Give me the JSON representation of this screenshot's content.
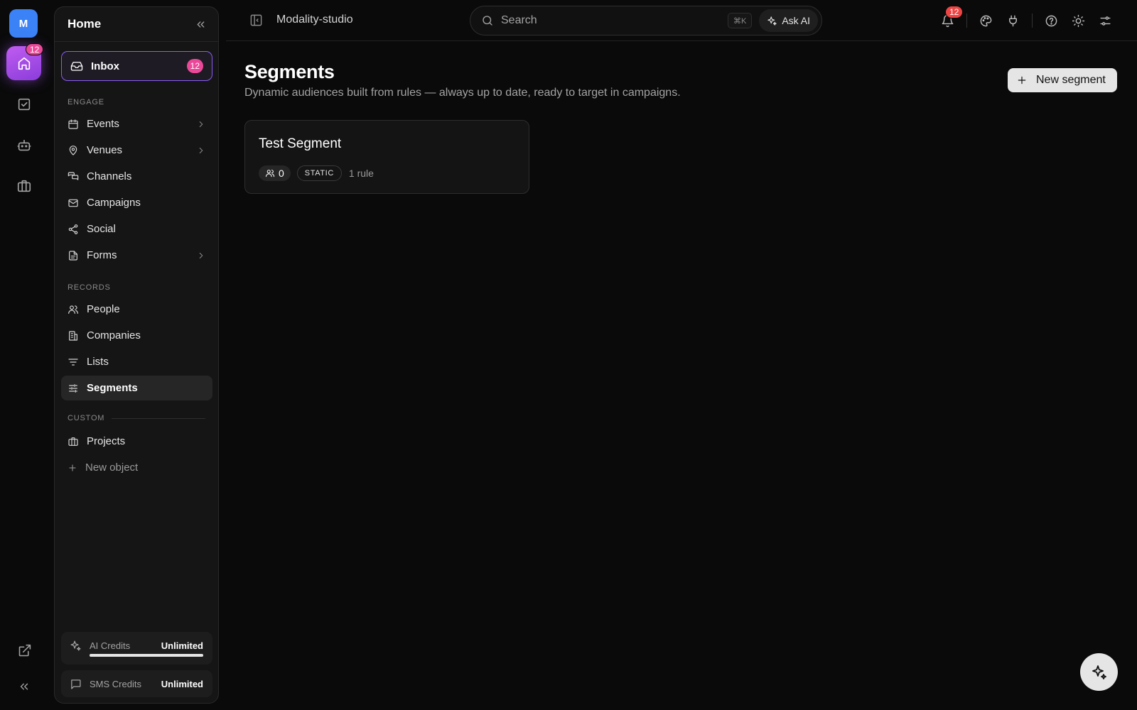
{
  "rail": {
    "workspace_initial": "M",
    "home_badge": "12",
    "icons": [
      "home-icon",
      "tasks-icon",
      "bot-icon",
      "briefcase-icon",
      "external-link-icon",
      "collapse-icon"
    ]
  },
  "sidebar": {
    "title": "Home",
    "inbox": {
      "label": "Inbox",
      "count": "12"
    },
    "engage_label": "ENGAGE",
    "engage": [
      {
        "label": "Events",
        "icon": "calendar-icon",
        "has_children": true
      },
      {
        "label": "Venues",
        "icon": "map-pin-icon",
        "has_children": true
      },
      {
        "label": "Channels",
        "icon": "chat-icon",
        "has_children": false
      },
      {
        "label": "Campaigns",
        "icon": "mail-icon",
        "has_children": false
      },
      {
        "label": "Social",
        "icon": "share-icon",
        "has_children": false
      },
      {
        "label": "Forms",
        "icon": "document-icon",
        "has_children": true
      }
    ],
    "records_label": "RECORDS",
    "records": [
      {
        "label": "People",
        "icon": "users-icon"
      },
      {
        "label": "Companies",
        "icon": "building-icon"
      },
      {
        "label": "Lists",
        "icon": "filter-icon"
      },
      {
        "label": "Segments",
        "icon": "sliders-icon",
        "active": true
      }
    ],
    "custom_label": "CUSTOM",
    "custom": [
      {
        "label": "Projects",
        "icon": "briefcase-icon"
      },
      {
        "label": "New object",
        "icon": "plus-icon"
      }
    ],
    "credits": {
      "ai_label": "AI Credits",
      "ai_value": "Unlimited",
      "ai_fill": 1.0,
      "sms_label": "SMS Credits",
      "sms_value": "Unlimited"
    }
  },
  "topbar": {
    "workspace": "Modality-studio",
    "search_placeholder": "Search",
    "shortcut": "⌘K",
    "ask_ai": "Ask AI",
    "notification_count": "12"
  },
  "main": {
    "title": "Segments",
    "subtitle": "Dynamic audiences built from rules — always up to date, ready to target in campaigns.",
    "new_button": "New segment",
    "segments": [
      {
        "name": "Test Segment",
        "members": "0",
        "type": "STATIC",
        "rules": "1 rule"
      }
    ]
  },
  "colors": {
    "accent": "#8b5cf6",
    "badge_pink": "#ec4899",
    "badge_red": "#ef4444",
    "workspace_blue": "#3b82f6"
  }
}
